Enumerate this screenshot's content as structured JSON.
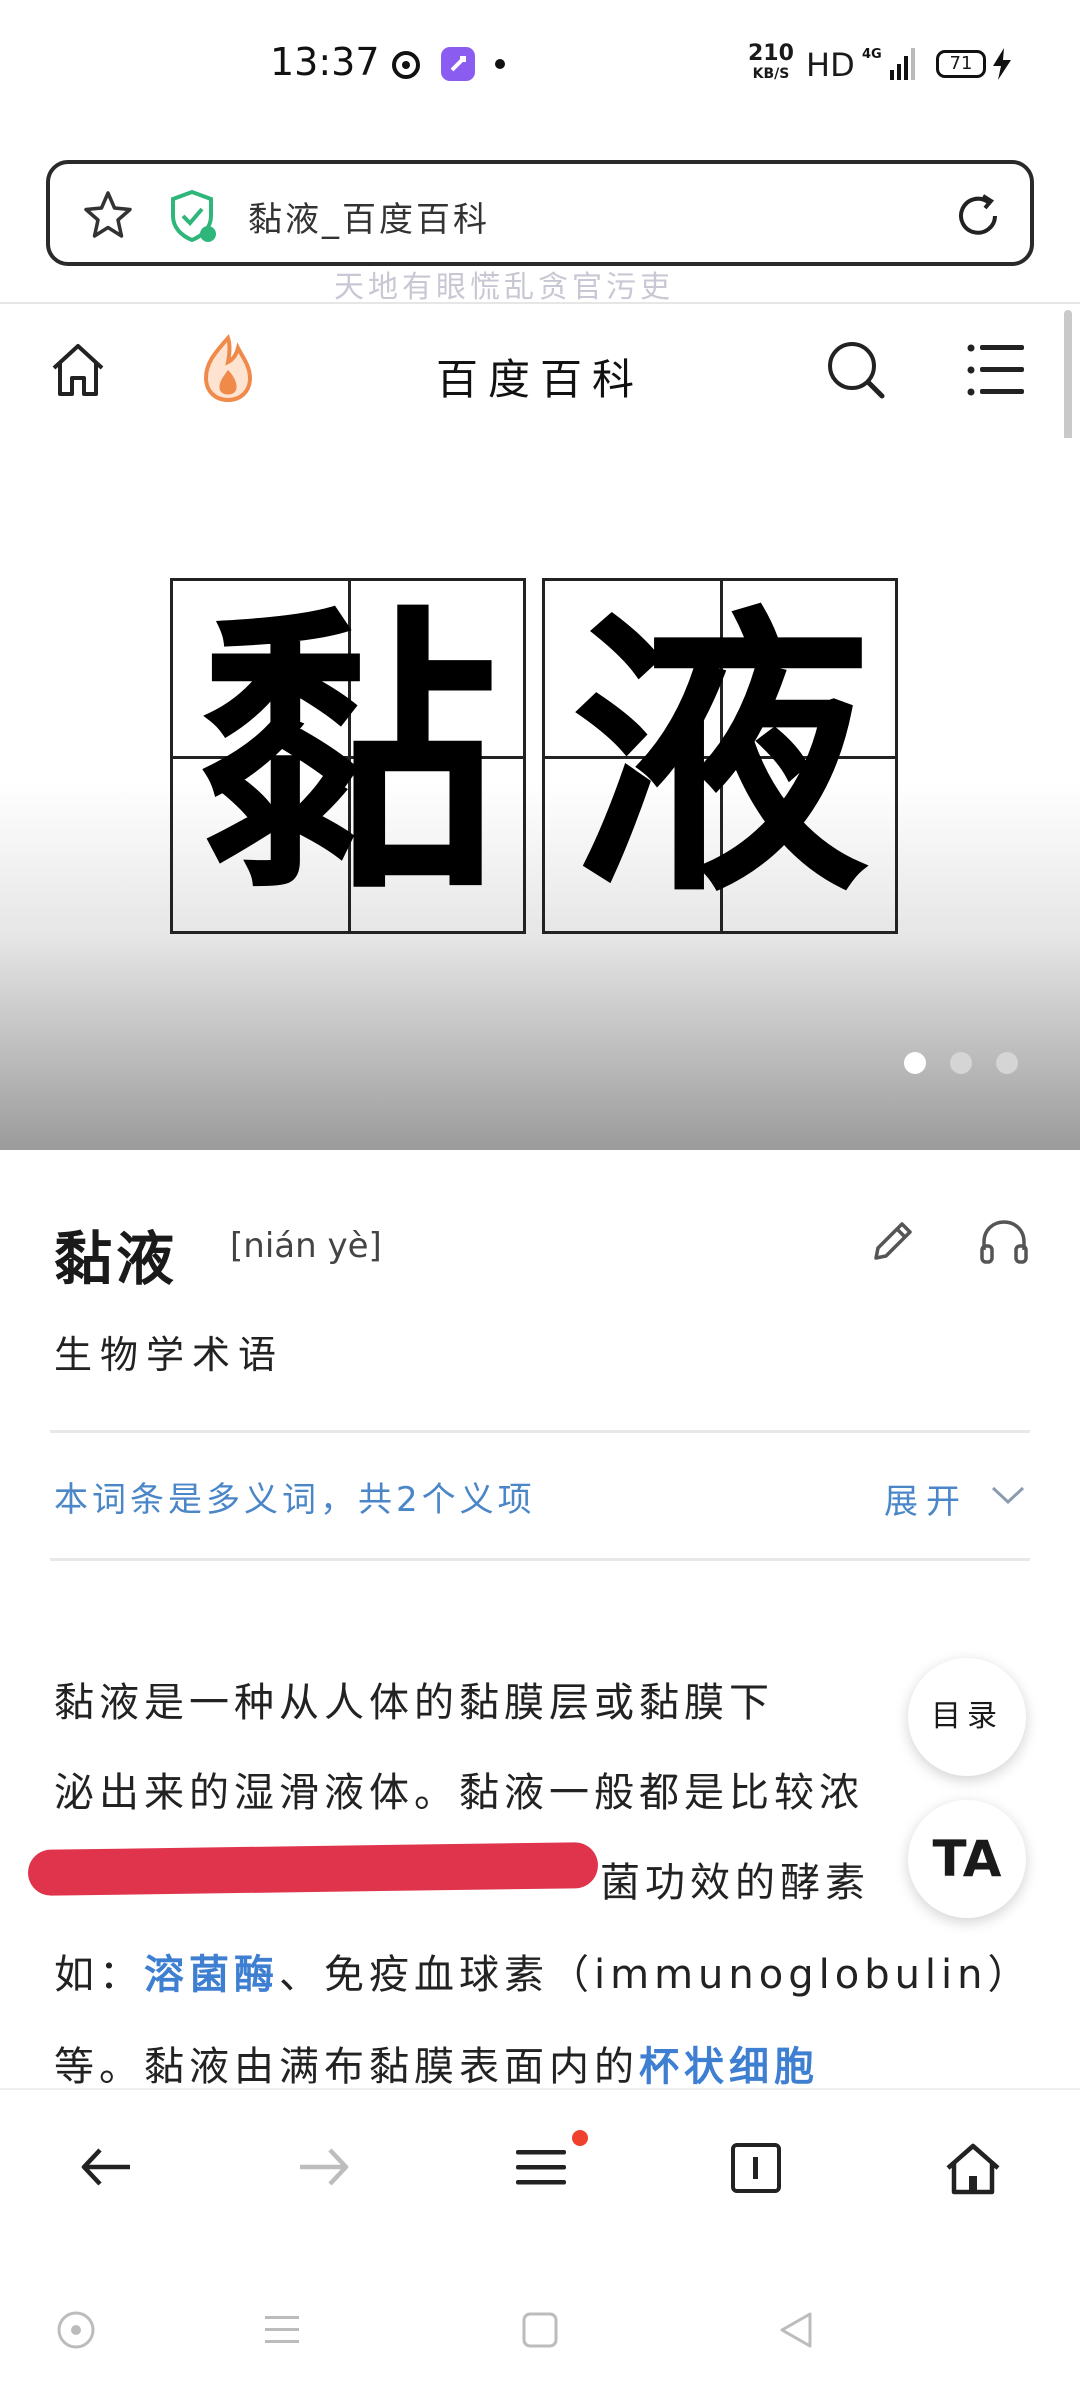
{
  "status_bar": {
    "time": "13:37",
    "net_speed_value": "210",
    "net_speed_unit": "KB/S",
    "hd": "HD",
    "network": "4G",
    "battery": "71"
  },
  "url_bar": {
    "title": "黏液_百度百科",
    "watermark": "天地有眼慌乱贪官污吏"
  },
  "site_header": {
    "title": "百度百科"
  },
  "hero": {
    "characters": [
      "黏",
      "液"
    ],
    "dot_count": 3,
    "active_dot": 0
  },
  "term": {
    "title": "黏液",
    "pinyin": "[nián yè]",
    "subtitle": "生物学术语"
  },
  "polysemy": {
    "text": "本词条是多义词，共2个义项",
    "expand_label": "展开"
  },
  "content": {
    "line1": "黏液是一种从人体的黏膜层或黏膜下",
    "line2": "泌出来的湿滑液体。黏液一般都是比较浓",
    "line3_visible": "菌功效的酵素",
    "line4_prefix": "如：",
    "line4_link": "溶菌酶",
    "line4_suffix": "、免疫血球素（immunoglobulin）",
    "line5_prefix": "等。黏液由满布黏膜表面内的",
    "line5_link": "杯状细胞"
  },
  "floating": {
    "toc_label": "目录",
    "ta_label": "TA"
  },
  "colors": {
    "link": "#3f7fd1",
    "polysemy": "#4a86c8",
    "redaction": "#e0344d",
    "notification_dot": "#f0412e",
    "fire_accent": "#f08a4b"
  }
}
